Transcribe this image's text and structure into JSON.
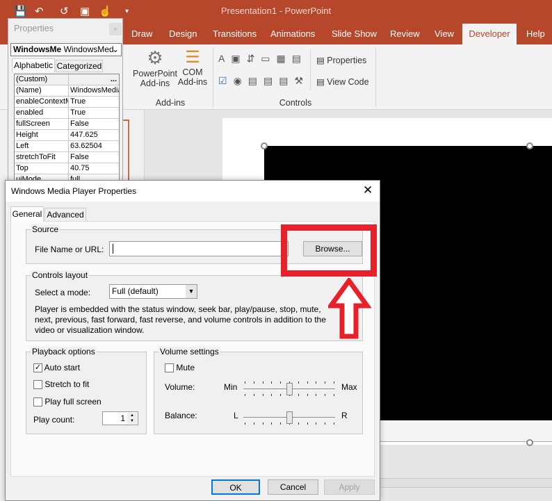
{
  "app": {
    "title": "Presentation1  -  PowerPoint",
    "accent": "#b7472a"
  },
  "quick_access": [
    "save-icon",
    "undo-icon",
    "redo-icon",
    "slideshow-icon",
    "touch-mode-icon",
    "customize-icon"
  ],
  "ribbon": {
    "tabs": [
      "Draw",
      "Design",
      "Transitions",
      "Animations",
      "Slide Show",
      "Review",
      "View",
      "Developer",
      "Help"
    ],
    "active_tab": "Developer",
    "addins": {
      "ppt_addins": [
        "PowerPoint",
        "Add-ins"
      ],
      "com_addins": [
        "COM",
        "Add-ins"
      ],
      "group_label": "Add-ins"
    },
    "controls": {
      "properties": "Properties",
      "view_code": "View Code",
      "group_label": "Controls"
    }
  },
  "properties_panel": {
    "title": "Properties",
    "object_name": "WindowsMe",
    "object_type": "WindowsMed",
    "tabs": [
      "Alphabetic",
      "Categorized"
    ],
    "rows": [
      [
        "(Custom)",
        "..."
      ],
      [
        "(Name)",
        "WindowsMedia"
      ],
      [
        "enableContextMenu",
        "True"
      ],
      [
        "enabled",
        "True"
      ],
      [
        "fullScreen",
        "False"
      ],
      [
        "Height",
        "447.625"
      ],
      [
        "Left",
        "63.62504"
      ],
      [
        "stretchToFit",
        "False"
      ],
      [
        "Top",
        "40.75"
      ],
      [
        "uiMode",
        "full"
      ]
    ]
  },
  "dialog": {
    "title": "Windows Media Player Properties",
    "tabs": [
      "General",
      "Advanced"
    ],
    "source": {
      "label": "Source",
      "file_label": "File Name or URL:",
      "file_value": "",
      "browse": "Browse..."
    },
    "controls_layout": {
      "label": "Controls layout",
      "mode_label": "Select a mode:",
      "mode_value": "Full (default)",
      "description": "Player is embedded with the status window, seek bar, play/pause, stop, mute, next, previous, fast forward, fast reverse, and volume controls in addition to the video or visualization window."
    },
    "playback": {
      "label": "Playback options",
      "auto_start": "Auto start",
      "auto_start_checked": true,
      "stretch": "Stretch to fit",
      "stretch_checked": false,
      "full_screen": "Play full screen",
      "full_screen_checked": false,
      "play_count_label": "Play count:",
      "play_count": "1"
    },
    "volume": {
      "label": "Volume settings",
      "mute": "Mute",
      "mute_checked": false,
      "volume_label": "Volume:",
      "min": "Min",
      "max": "Max",
      "volume_level": 0.5,
      "balance_label": "Balance:",
      "left": "L",
      "right": "R",
      "balance_level": 0.5
    },
    "buttons": {
      "ok": "OK",
      "cancel": "Cancel",
      "apply": "Apply"
    }
  },
  "annotation": {
    "color": "#e8202a"
  }
}
